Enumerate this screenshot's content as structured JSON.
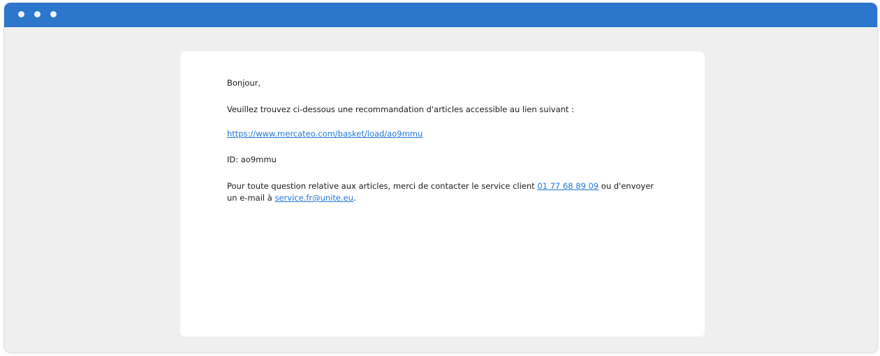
{
  "window": {
    "titlebar_color": "#2c77cc",
    "controls": [
      "window-dot",
      "window-dot",
      "window-dot"
    ]
  },
  "email": {
    "greeting": "Bonjour,",
    "intro": "Veuillez trouvez ci-dessous une recommandation d'articles accessible au lien suivant :",
    "basket_link": "https://www.mercateo.com/basket/load/ao9mmu",
    "id_line": "ID: ao9mmu",
    "contact_text_1": "Pour toute question relative aux articles, merci de contacter le service client ",
    "phone_link": "01 77 68 89 09",
    "contact_text_2": " ou d'envoyer",
    "contact_text_3": "un e-mail à ",
    "email_link": "service.fr@unite.eu",
    "contact_text_4": "."
  }
}
